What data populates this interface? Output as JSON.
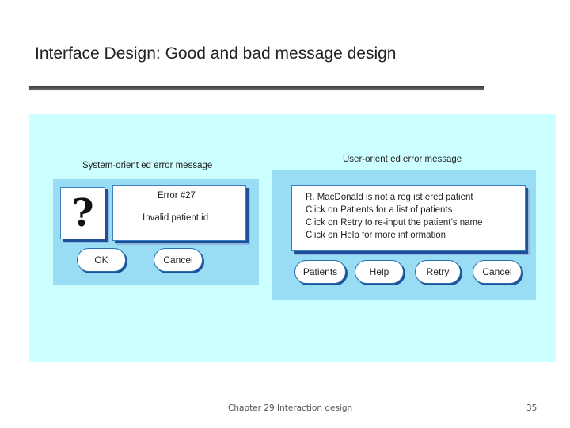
{
  "slide": {
    "title": "Interface Design: Good and bad message design",
    "footer": "Chapter 29 Interaction design",
    "page_number": "35"
  },
  "colors": {
    "diagram_background": "#ccffff",
    "panel_background": "#99ddf5",
    "window_border": "#3a7fc1",
    "window_shadow": "#1f4f99"
  },
  "system_panel": {
    "caption": "System-orient ed error message",
    "icon": "question-mark-icon",
    "icon_glyph": "?",
    "error_title": "Error #27",
    "error_text": "Invalid patient id",
    "buttons": [
      "OK",
      "Cancel"
    ]
  },
  "user_panel": {
    "caption": "User-orient ed error message",
    "lines": [
      "R. MacDonald is not a reg       ist ered patient",
      "Click on Patients for a list of patients",
      "Click on Retry to re-input the patient’s name",
      "Click on Help for more inf ormation"
    ],
    "buttons": [
      "Patients",
      "Help",
      "Retry",
      "Cancel"
    ]
  }
}
